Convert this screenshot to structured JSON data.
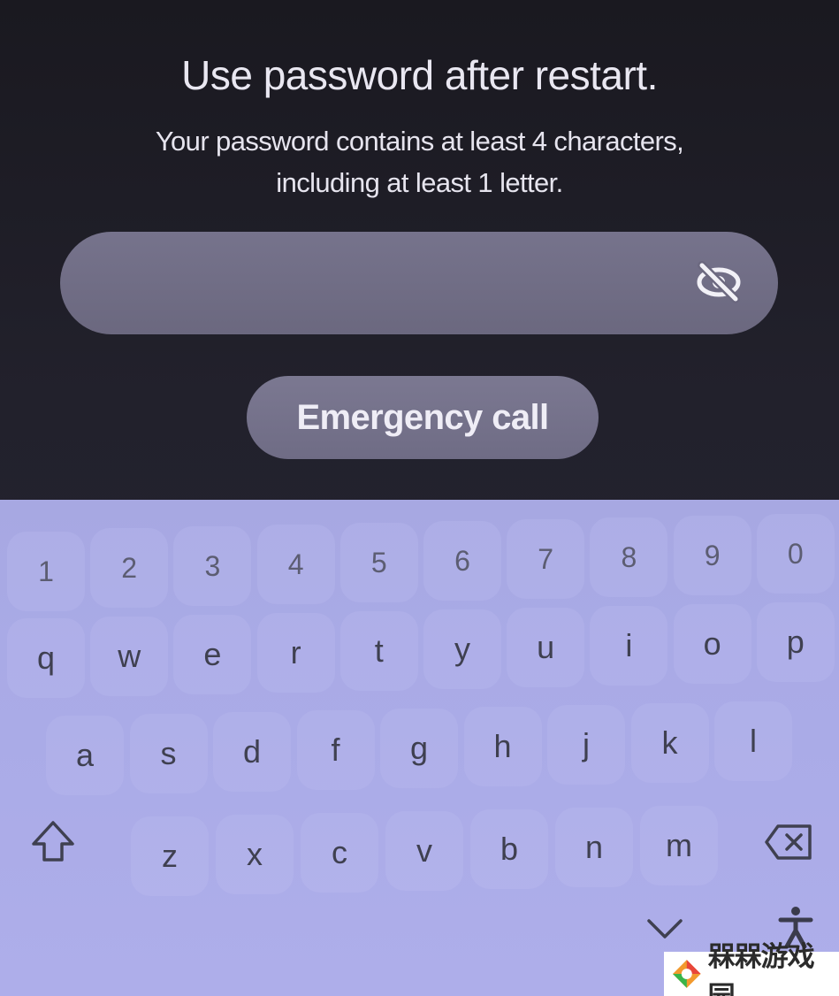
{
  "lock_screen": {
    "title": "Use password after restart.",
    "subtitle_line1": "Your password contains at least 4 characters,",
    "subtitle_line2": "including at least 1 letter.",
    "password_value": "",
    "emergency_label": "Emergency call",
    "visibility_icon": "eye-off-icon"
  },
  "keyboard": {
    "number_row": [
      "1",
      "2",
      "3",
      "4",
      "5",
      "6",
      "7",
      "8",
      "9",
      "0"
    ],
    "row1": [
      "q",
      "w",
      "e",
      "r",
      "t",
      "y",
      "u",
      "i",
      "o",
      "p"
    ],
    "row2": [
      "a",
      "s",
      "d",
      "f",
      "g",
      "h",
      "j",
      "k",
      "l"
    ],
    "row3": [
      "z",
      "x",
      "c",
      "v",
      "b",
      "n",
      "m"
    ],
    "shift_icon": "shift-icon",
    "backspace_icon": "backspace-icon",
    "hide_icon": "chevron-down-icon",
    "accessibility_icon": "accessibility-icon"
  },
  "watermark": {
    "text": "槑槑游戏园"
  },
  "colors": {
    "background": "#1c1b24",
    "field": "#716e86",
    "keyboard": "#aaabe6",
    "key_text": "#3f4050"
  }
}
